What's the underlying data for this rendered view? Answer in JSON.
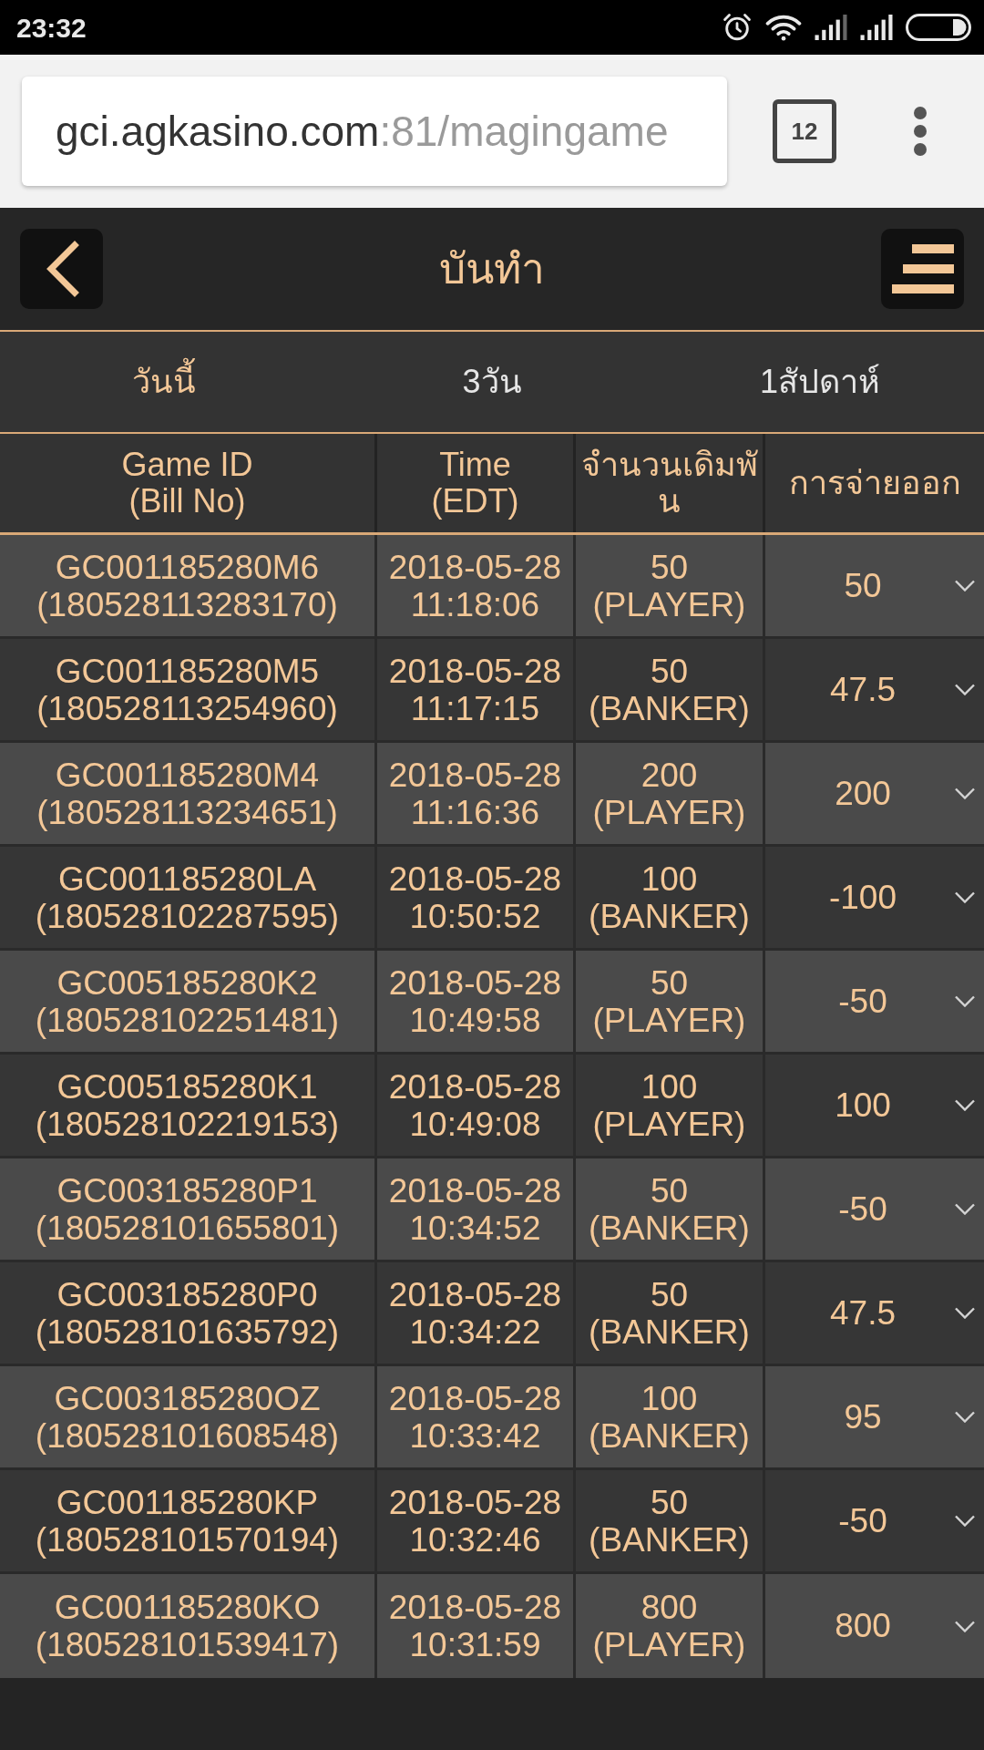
{
  "status_bar": {
    "time": "23:32"
  },
  "browser": {
    "url_host": "gci.agkasino.com",
    "url_rest": ":81/magingame",
    "tab_count": "12"
  },
  "header": {
    "title": "บันทำ"
  },
  "tabs": [
    {
      "label": "วันนี้",
      "selected": true
    },
    {
      "label": "3วัน",
      "selected": false
    },
    {
      "label": "1สัปดาห์",
      "selected": false
    }
  ],
  "table": {
    "columns": [
      {
        "title": "Game ID",
        "subtitle": "(Bill No)"
      },
      {
        "title": "Time",
        "subtitle": "(EDT)"
      },
      {
        "title": "จำนวนเดิมพัน"
      },
      {
        "title": "การจ่ายออก"
      }
    ],
    "rows": [
      {
        "game_id": "GC001185280M6",
        "bill_no": "(180528113283170)",
        "date": "2018-05-28",
        "time": "11:18:06",
        "amount": "50",
        "bet": "(PLAYER)",
        "payout": "50"
      },
      {
        "game_id": "GC001185280M5",
        "bill_no": "(180528113254960)",
        "date": "2018-05-28",
        "time": "11:17:15",
        "amount": "50",
        "bet": "(BANKER)",
        "payout": "47.5"
      },
      {
        "game_id": "GC001185280M4",
        "bill_no": "(180528113234651)",
        "date": "2018-05-28",
        "time": "11:16:36",
        "amount": "200",
        "bet": "(PLAYER)",
        "payout": "200"
      },
      {
        "game_id": "GC001185280LA",
        "bill_no": "(180528102287595)",
        "date": "2018-05-28",
        "time": "10:50:52",
        "amount": "100",
        "bet": "(BANKER)",
        "payout": "-100"
      },
      {
        "game_id": "GC005185280K2",
        "bill_no": "(180528102251481)",
        "date": "2018-05-28",
        "time": "10:49:58",
        "amount": "50",
        "bet": "(PLAYER)",
        "payout": "-50"
      },
      {
        "game_id": "GC005185280K1",
        "bill_no": "(180528102219153)",
        "date": "2018-05-28",
        "time": "10:49:08",
        "amount": "100",
        "bet": "(PLAYER)",
        "payout": "100"
      },
      {
        "game_id": "GC003185280P1",
        "bill_no": "(180528101655801)",
        "date": "2018-05-28",
        "time": "10:34:52",
        "amount": "50",
        "bet": "(BANKER)",
        "payout": "-50"
      },
      {
        "game_id": "GC003185280P0",
        "bill_no": "(180528101635792)",
        "date": "2018-05-28",
        "time": "10:34:22",
        "amount": "50",
        "bet": "(BANKER)",
        "payout": "47.5"
      },
      {
        "game_id": "GC003185280OZ",
        "bill_no": "(180528101608548)",
        "date": "2018-05-28",
        "time": "10:33:42",
        "amount": "100",
        "bet": "(BANKER)",
        "payout": "95"
      },
      {
        "game_id": "GC001185280KP",
        "bill_no": "(180528101570194)",
        "date": "2018-05-28",
        "time": "10:32:46",
        "amount": "50",
        "bet": "(BANKER)",
        "payout": "-50"
      },
      {
        "game_id": "GC001185280KO",
        "bill_no": "(180528101539417)",
        "date": "2018-05-28",
        "time": "10:31:59",
        "amount": "800",
        "bet": "(PLAYER)",
        "payout": "800"
      }
    ]
  }
}
